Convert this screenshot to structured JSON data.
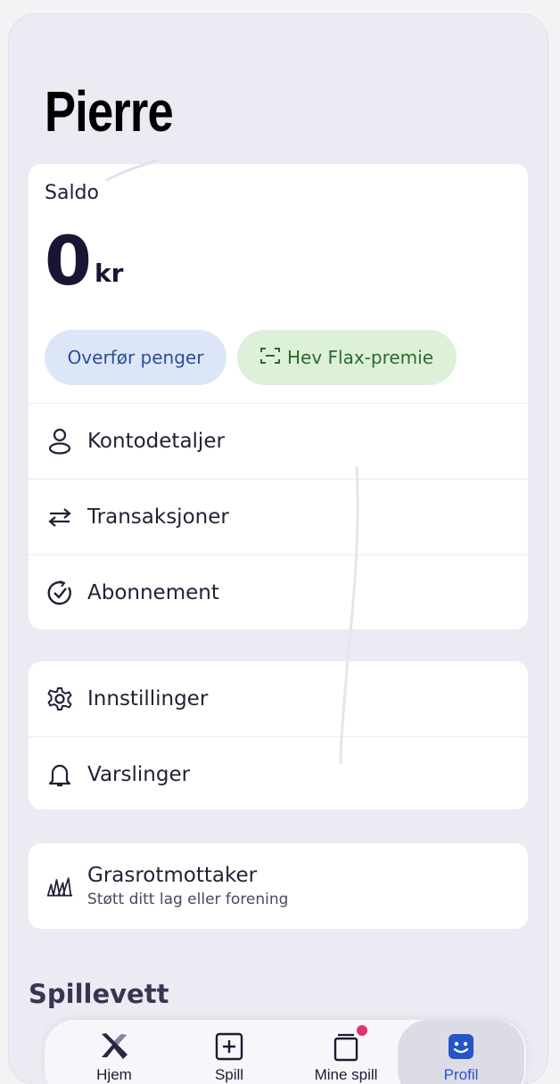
{
  "profile": {
    "name": "Pierre"
  },
  "balance": {
    "label": "Saldo",
    "amount": "0",
    "currency": "kr",
    "transfer_button": "Overfør penger",
    "flax_button": "Hev Flax-premie"
  },
  "account_menu": [
    {
      "label": "Kontodetaljer",
      "icon": "person-icon"
    },
    {
      "label": "Transaksjoner",
      "icon": "arrows-icon"
    },
    {
      "label": "Abonnement",
      "icon": "check-circle-icon"
    }
  ],
  "settings_menu": [
    {
      "label": "Innstillinger",
      "icon": "gear-icon"
    },
    {
      "label": "Varslinger",
      "icon": "bell-icon"
    }
  ],
  "grassroots": {
    "title": "Grasrotmottaker",
    "subtitle": "Støtt ditt lag eller forening",
    "icon": "grass-icon"
  },
  "section_heading": "Spillevett",
  "bottom_nav": [
    {
      "label": "Hjem",
      "icon": "home-x-icon"
    },
    {
      "label": "Spill",
      "icon": "plus-square-icon"
    },
    {
      "label": "Mine spill",
      "icon": "cards-icon"
    },
    {
      "label": "Profil",
      "icon": "smiley-icon"
    }
  ],
  "colors": {
    "accent_blue": "#2b4e9a",
    "green": "#2c6a2a",
    "badge": "#e2336b",
    "profile_active": "#2456c9"
  }
}
